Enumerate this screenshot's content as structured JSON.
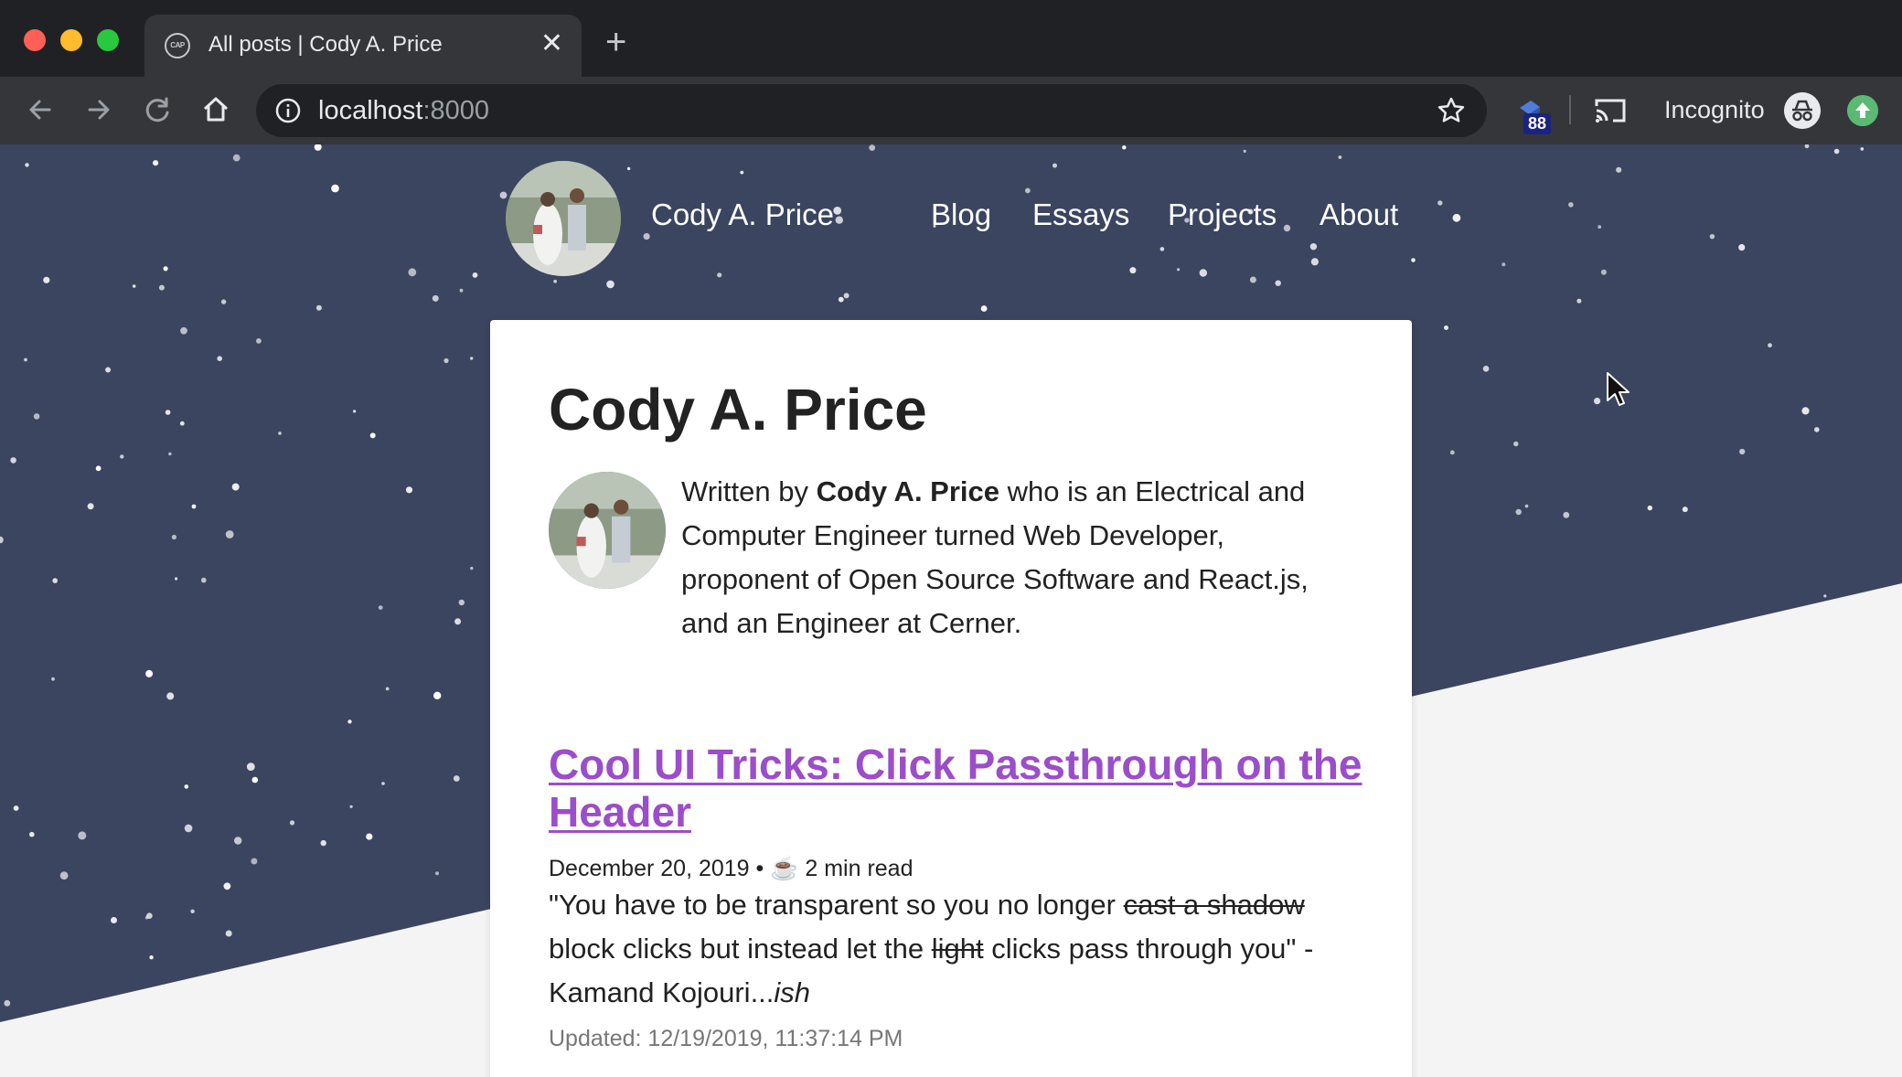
{
  "browser": {
    "tab_title": "All posts | Cody A. Price",
    "favicon_text": "CAP",
    "close_glyph": "✕",
    "new_tab_glyph": "+",
    "url_host": "localhost",
    "url_port": ":8000",
    "extension_badge": "88",
    "incognito_label": "Incognito"
  },
  "site": {
    "name": "Cody A. Price",
    "nav": [
      "Blog",
      "Essays",
      "Projects",
      "About"
    ]
  },
  "card": {
    "title": "Cody A. Price",
    "bio": {
      "prefix": "Written by ",
      "name": "Cody A. Price",
      "rest": " who is an Electrical and Computer Engineer turned Web Developer, proponent of Open Source Software and React.js, and an Engineer at Cerner."
    }
  },
  "post": {
    "title": "Cool UI Tricks: Click Passthrough on the Header",
    "date": "December 20, 2019",
    "bullet": "•",
    "coffee": "☕️",
    "read_time": "2 min read",
    "excerpt": {
      "p1": "\"You have to be transparent so you no longer ",
      "strike1": "cast a shadow",
      "p2": " block clicks but instead let the ",
      "strike2": "light",
      "p3": " clicks pass through you\" - Kamand Kojouri...",
      "em": "ish"
    },
    "updated": "Updated: 12/19/2019, 11:37:14 PM"
  },
  "colors": {
    "sky": "#3b4560",
    "link_purple": "#9b4dca",
    "chrome_dark": "#202124",
    "chrome_toolbar": "#35363a"
  }
}
